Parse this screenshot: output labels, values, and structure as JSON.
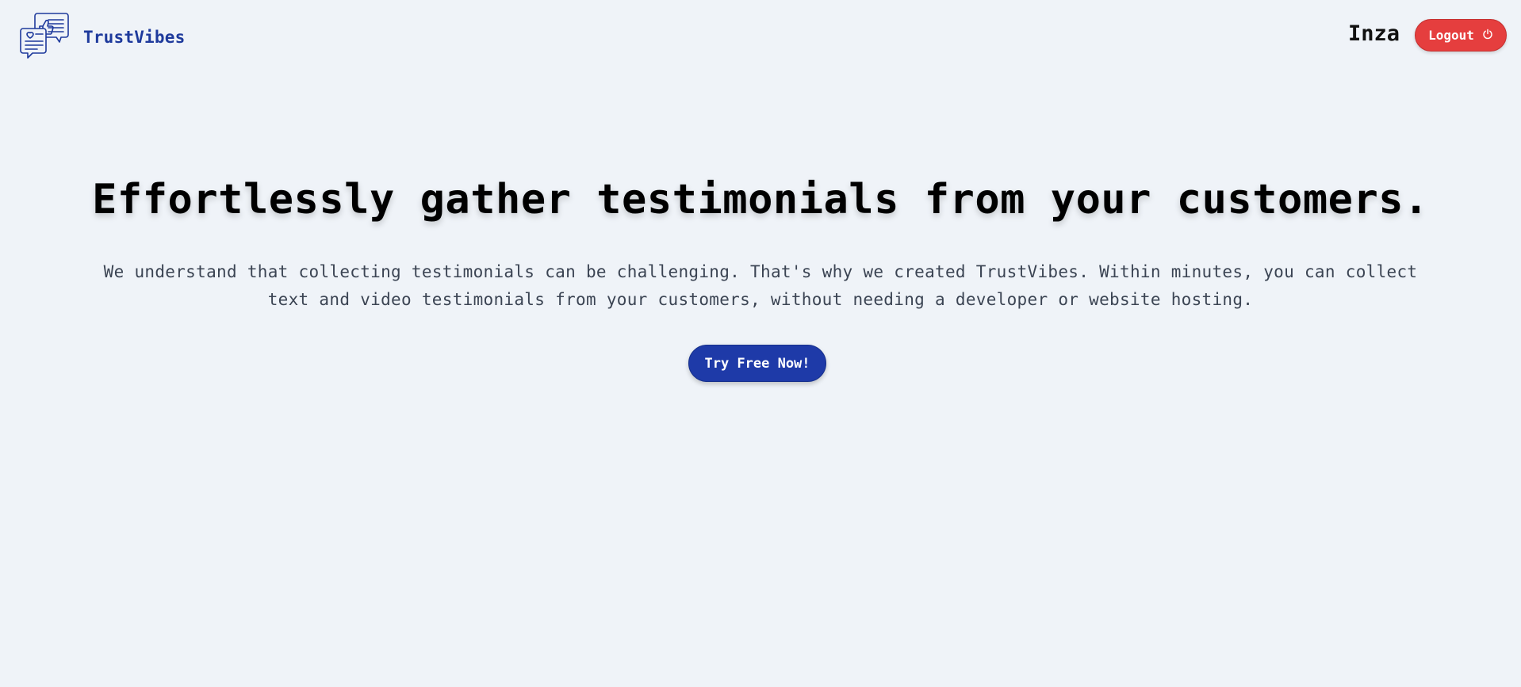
{
  "header": {
    "brand_name": "TrustVibes",
    "logo_icon": "testimonial-chat-icon",
    "user_name": "Inza",
    "logout_label": "Logout",
    "logout_icon": "power-icon"
  },
  "hero": {
    "title": "Effortlessly gather testimonials from your customers.",
    "description": "We understand that collecting testimonials can be challenging. That's why we created TrustVibes. Within minutes, you can collect text and video testimonials from your customers, without needing a developer or website hosting.",
    "cta_label": "Try Free Now!"
  },
  "colors": {
    "background": "#eff3f8",
    "brand": "#1e3a9c",
    "logout": "#e53e3e",
    "cta": "#1e3aa8"
  }
}
